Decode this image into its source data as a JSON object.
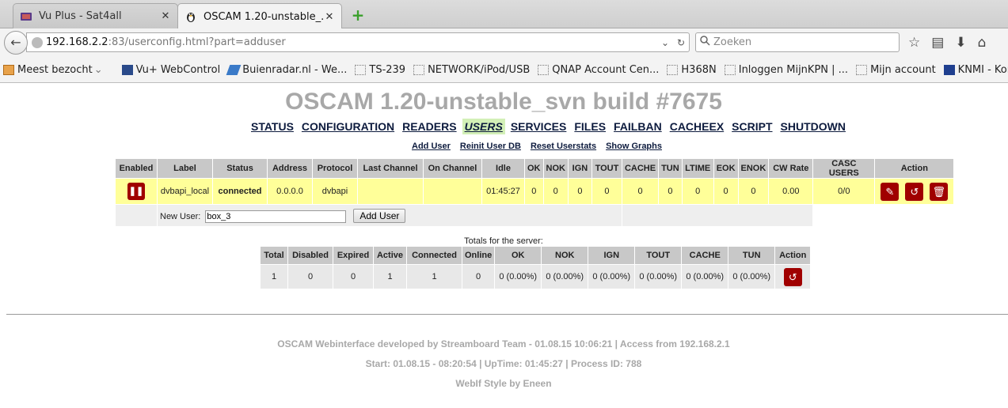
{
  "browser": {
    "tabs": [
      {
        "title": "Vu Plus - Sat4all",
        "active": false
      },
      {
        "title": "OSCAM 1.20-unstable_...",
        "active": true
      }
    ],
    "url_host": "192.168.2.2",
    "url_path": ":83/userconfig.html?part=adduser",
    "search_placeholder": "Zoeken",
    "bookmarks": [
      {
        "label": "Meest bezocht",
        "icon": "folder-icon"
      },
      {
        "label": "Vu+ WebControl",
        "icon": "vu-icon"
      },
      {
        "label": "Buienradar.nl - We...",
        "icon": "rain-icon"
      },
      {
        "label": "TS-239",
        "icon": "page-icon"
      },
      {
        "label": "NETWORK/iPod/USB",
        "icon": "page-icon"
      },
      {
        "label": "QNAP Account Cen...",
        "icon": "page-icon"
      },
      {
        "label": "H368N",
        "icon": "page-icon"
      },
      {
        "label": "Inloggen MijnKPN | ...",
        "icon": "page-icon"
      },
      {
        "label": "Mijn account",
        "icon": "page-icon"
      },
      {
        "label": "KNMI - Koninklijk N...",
        "icon": "knmi-icon"
      }
    ]
  },
  "page": {
    "title": "OSCAM 1.20-unstable_svn build #7675",
    "menu": [
      "STATUS",
      "CONFIGURATION",
      "READERS",
      "USERS",
      "SERVICES",
      "FILES",
      "FAILBAN",
      "CACHEEX",
      "SCRIPT",
      "SHUTDOWN"
    ],
    "active_menu": "USERS",
    "submenu": [
      "Add User",
      "Reinit User DB",
      "Reset Userstats",
      "Show Graphs"
    ]
  },
  "users_table": {
    "headers": [
      "Enabled",
      "Label",
      "Status",
      "Address",
      "Protocol",
      "Last Channel",
      "On Channel",
      "Idle",
      "OK",
      "NOK",
      "IGN",
      "TOUT",
      "CACHE",
      "TUN",
      "LTIME",
      "EOK",
      "ENOK",
      "CW Rate",
      "CASC USERS",
      "Action"
    ],
    "row": {
      "label": "dvbapi_local",
      "status": "connected",
      "address": "0.0.0.0",
      "protocol": "dvbapi",
      "last_channel": "",
      "on_channel": "",
      "idle": "01:45:27",
      "ok": "0",
      "nok": "0",
      "ign": "0",
      "tout": "0",
      "cache": "0",
      "tun": "0",
      "ltime": "0",
      "eok": "0",
      "enok": "0",
      "cw_rate": "0.00",
      "casc_users": "0/0"
    },
    "new_user_label": "New User:",
    "new_user_value": "box_3",
    "add_user_button": "Add User"
  },
  "totals": {
    "caption": "Totals for the server:",
    "headers": [
      "Total",
      "Disabled",
      "Expired",
      "Active",
      "Connected",
      "Online",
      "OK",
      "NOK",
      "IGN",
      "TOUT",
      "CACHE",
      "TUN",
      "Action"
    ],
    "values": [
      "1",
      "0",
      "0",
      "1",
      "1",
      "0",
      "0 (0.00%)",
      "0 (0.00%)",
      "0 (0.00%)",
      "0 (0.00%)",
      "0 (0.00%)",
      "0 (0.00%)"
    ]
  },
  "footer": {
    "line1": "OSCAM Webinterface developed by Streamboard Team - 01.08.15 10:06:21 | Access from 192.168.2.1",
    "line2": "Start: 01.08.15 - 08:20:54 | UpTime: 01:45:27 | Process ID: 788",
    "line3": "WebIf Style by Eneen"
  },
  "colors": {
    "accent_red": "#a00000",
    "row_highlight": "#ffff99",
    "active_menu_bg": "#d3f0b7",
    "title_gray": "#a8a8a8"
  }
}
